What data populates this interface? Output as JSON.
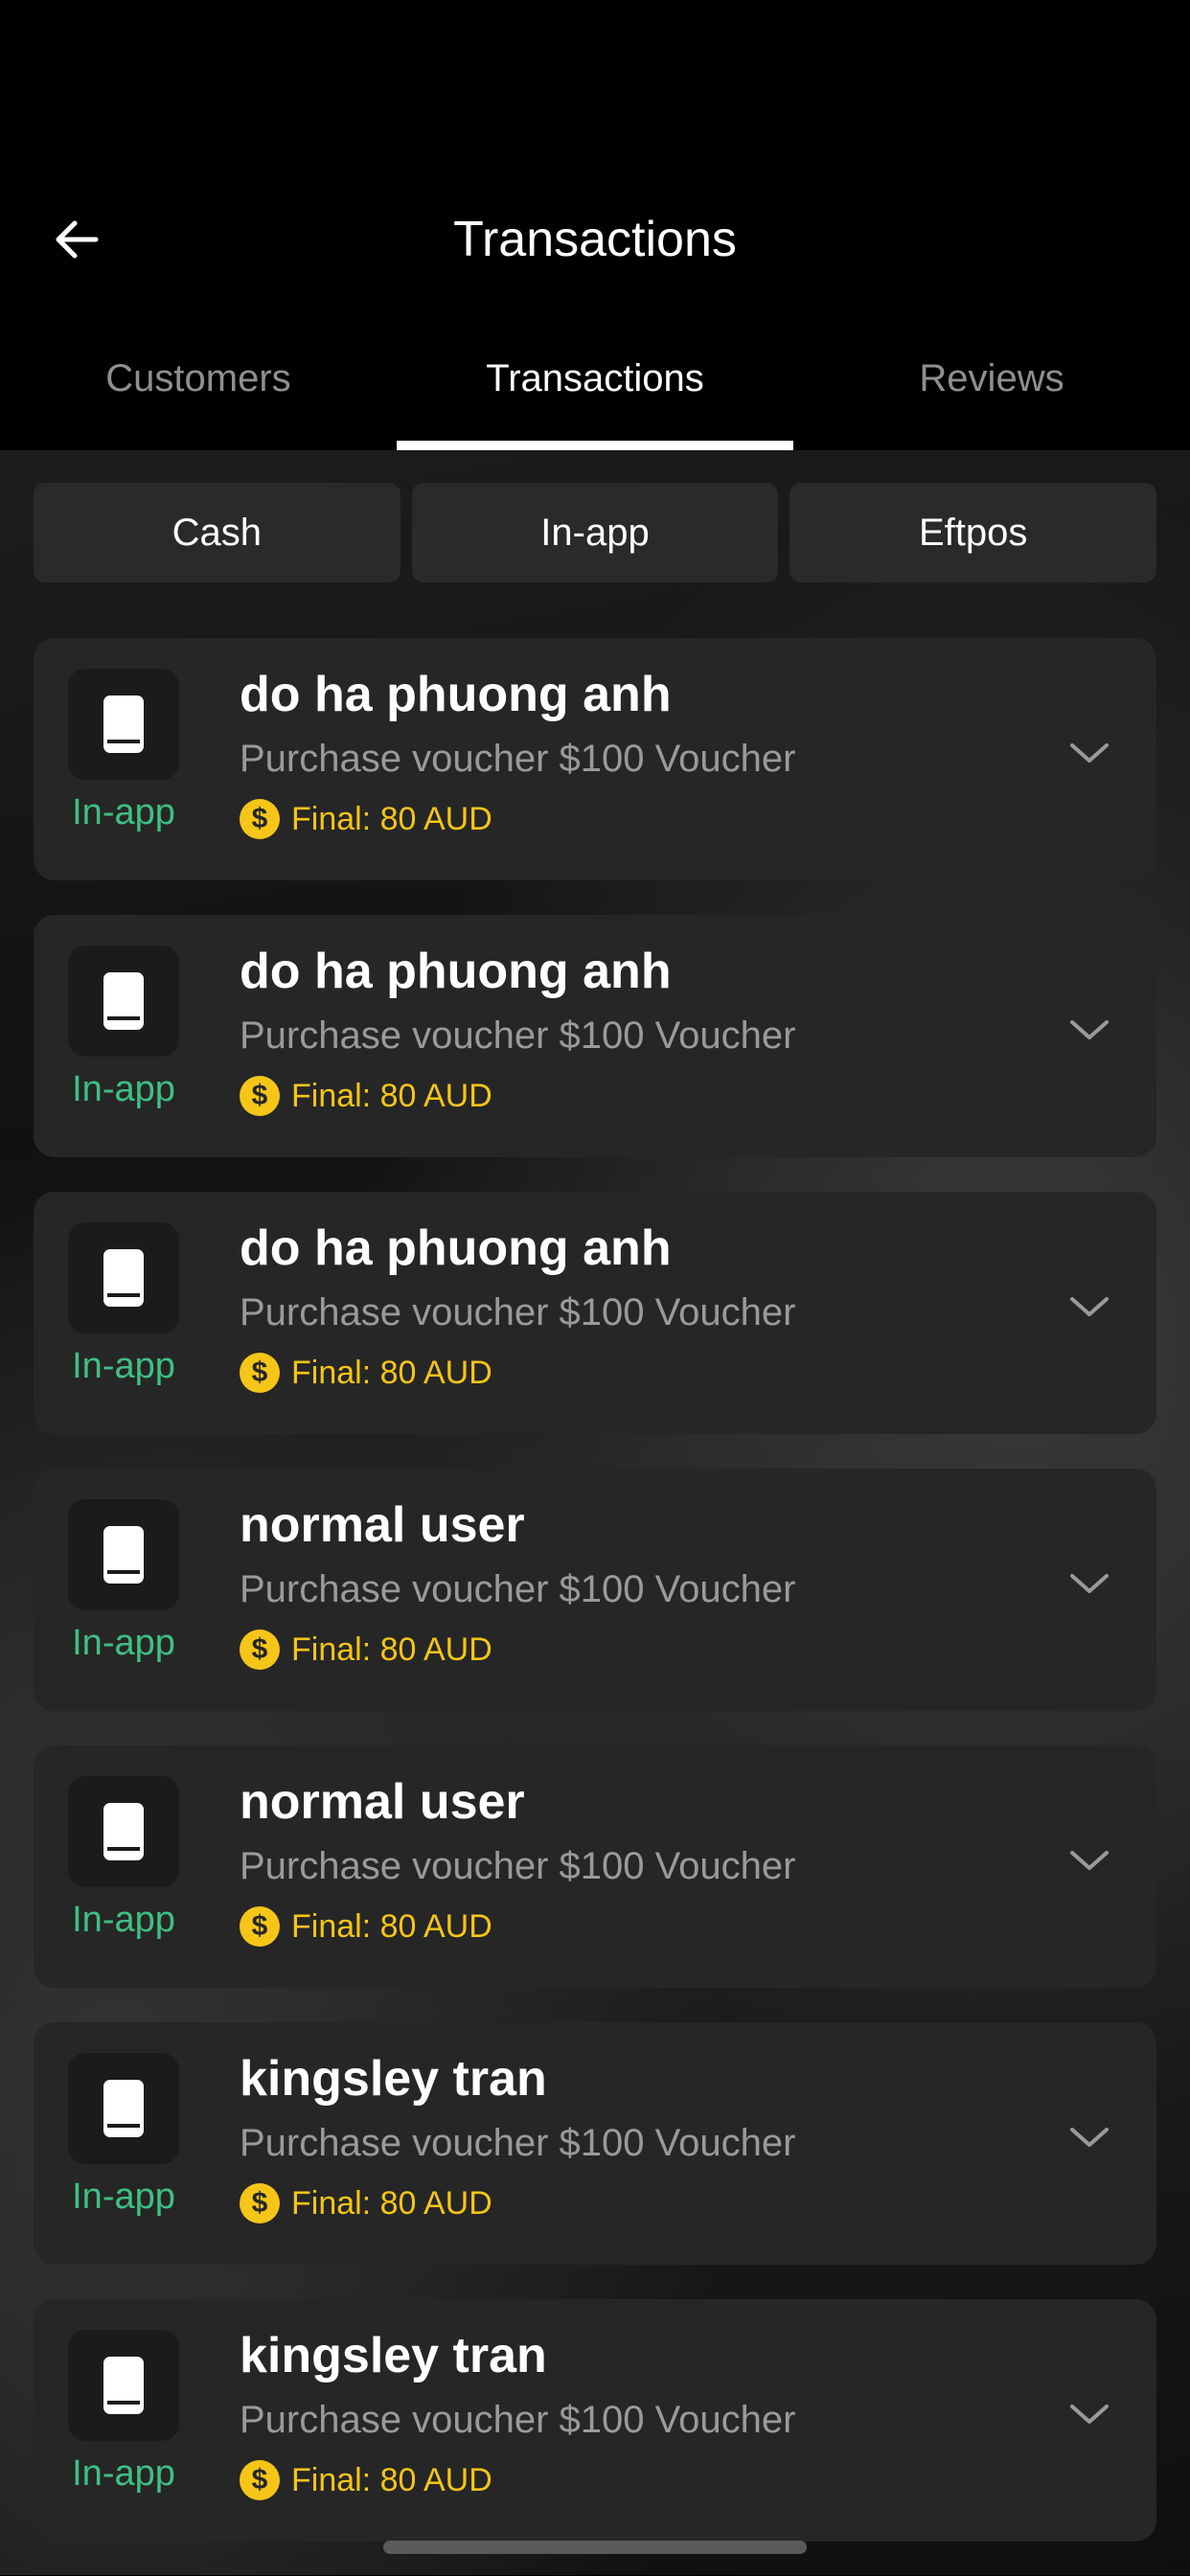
{
  "header": {
    "title": "Transactions",
    "back_icon": "arrow-left-icon"
  },
  "tabs": [
    {
      "label": "Customers",
      "active": false
    },
    {
      "label": "Transactions",
      "active": true
    },
    {
      "label": "Reviews",
      "active": false
    }
  ],
  "filters": [
    {
      "label": "Cash"
    },
    {
      "label": "In-app"
    },
    {
      "label": "Eftpos"
    }
  ],
  "transactions": [
    {
      "type_label": "In-app",
      "name": "do ha phuong anh",
      "description": "Purchase voucher $100 Voucher",
      "final": "Final: 80 AUD"
    },
    {
      "type_label": "In-app",
      "name": "do ha phuong anh",
      "description": "Purchase voucher $100 Voucher",
      "final": "Final: 80 AUD"
    },
    {
      "type_label": "In-app",
      "name": "do ha phuong anh",
      "description": "Purchase voucher $100 Voucher",
      "final": "Final: 80 AUD"
    },
    {
      "type_label": "In-app",
      "name": "normal user",
      "description": "Purchase voucher $100 Voucher",
      "final": "Final: 80 AUD"
    },
    {
      "type_label": "In-app",
      "name": "normal user",
      "description": "Purchase voucher $100 Voucher",
      "final": "Final: 80 AUD"
    },
    {
      "type_label": "In-app",
      "name": "kingsley tran",
      "description": "Purchase voucher $100 Voucher",
      "final": "Final: 80 AUD"
    },
    {
      "type_label": "In-app",
      "name": "kingsley tran",
      "description": "Purchase voucher $100 Voucher",
      "final": "Final: 80 AUD"
    }
  ],
  "icons": {
    "type": "smartphone-icon",
    "coin": "dollar-coin-icon",
    "coin_glyph": "$",
    "expand": "chevron-down-icon"
  },
  "colors": {
    "background": "#000000",
    "card": "#262626",
    "in_app_green": "#3fc083",
    "final_yellow": "#f5c518",
    "muted_text": "#9a9a9a"
  }
}
